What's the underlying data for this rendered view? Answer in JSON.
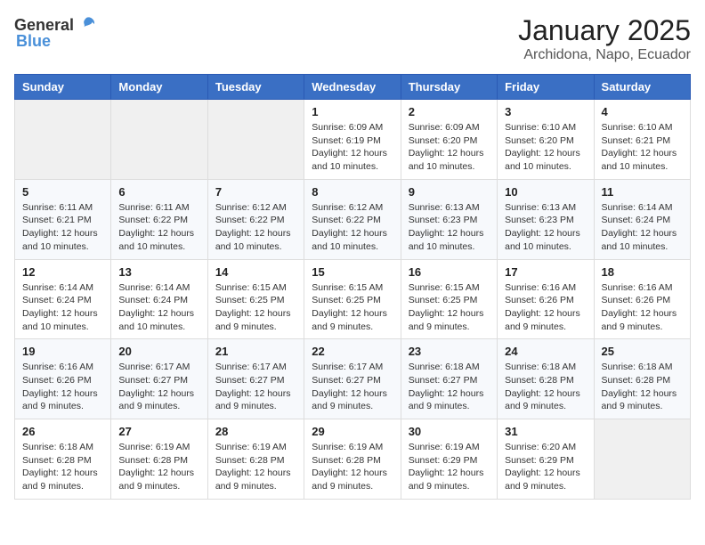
{
  "logo": {
    "text_general": "General",
    "text_blue": "Blue"
  },
  "title": "January 2025",
  "subtitle": "Archidona, Napo, Ecuador",
  "days_of_week": [
    "Sunday",
    "Monday",
    "Tuesday",
    "Wednesday",
    "Thursday",
    "Friday",
    "Saturday"
  ],
  "weeks": [
    [
      {
        "day": "",
        "info": ""
      },
      {
        "day": "",
        "info": ""
      },
      {
        "day": "",
        "info": ""
      },
      {
        "day": "1",
        "info": "Sunrise: 6:09 AM\nSunset: 6:19 PM\nDaylight: 12 hours and 10 minutes."
      },
      {
        "day": "2",
        "info": "Sunrise: 6:09 AM\nSunset: 6:20 PM\nDaylight: 12 hours and 10 minutes."
      },
      {
        "day": "3",
        "info": "Sunrise: 6:10 AM\nSunset: 6:20 PM\nDaylight: 12 hours and 10 minutes."
      },
      {
        "day": "4",
        "info": "Sunrise: 6:10 AM\nSunset: 6:21 PM\nDaylight: 12 hours and 10 minutes."
      }
    ],
    [
      {
        "day": "5",
        "info": "Sunrise: 6:11 AM\nSunset: 6:21 PM\nDaylight: 12 hours and 10 minutes."
      },
      {
        "day": "6",
        "info": "Sunrise: 6:11 AM\nSunset: 6:22 PM\nDaylight: 12 hours and 10 minutes."
      },
      {
        "day": "7",
        "info": "Sunrise: 6:12 AM\nSunset: 6:22 PM\nDaylight: 12 hours and 10 minutes."
      },
      {
        "day": "8",
        "info": "Sunrise: 6:12 AM\nSunset: 6:22 PM\nDaylight: 12 hours and 10 minutes."
      },
      {
        "day": "9",
        "info": "Sunrise: 6:13 AM\nSunset: 6:23 PM\nDaylight: 12 hours and 10 minutes."
      },
      {
        "day": "10",
        "info": "Sunrise: 6:13 AM\nSunset: 6:23 PM\nDaylight: 12 hours and 10 minutes."
      },
      {
        "day": "11",
        "info": "Sunrise: 6:14 AM\nSunset: 6:24 PM\nDaylight: 12 hours and 10 minutes."
      }
    ],
    [
      {
        "day": "12",
        "info": "Sunrise: 6:14 AM\nSunset: 6:24 PM\nDaylight: 12 hours and 10 minutes."
      },
      {
        "day": "13",
        "info": "Sunrise: 6:14 AM\nSunset: 6:24 PM\nDaylight: 12 hours and 10 minutes."
      },
      {
        "day": "14",
        "info": "Sunrise: 6:15 AM\nSunset: 6:25 PM\nDaylight: 12 hours and 9 minutes."
      },
      {
        "day": "15",
        "info": "Sunrise: 6:15 AM\nSunset: 6:25 PM\nDaylight: 12 hours and 9 minutes."
      },
      {
        "day": "16",
        "info": "Sunrise: 6:15 AM\nSunset: 6:25 PM\nDaylight: 12 hours and 9 minutes."
      },
      {
        "day": "17",
        "info": "Sunrise: 6:16 AM\nSunset: 6:26 PM\nDaylight: 12 hours and 9 minutes."
      },
      {
        "day": "18",
        "info": "Sunrise: 6:16 AM\nSunset: 6:26 PM\nDaylight: 12 hours and 9 minutes."
      }
    ],
    [
      {
        "day": "19",
        "info": "Sunrise: 6:16 AM\nSunset: 6:26 PM\nDaylight: 12 hours and 9 minutes."
      },
      {
        "day": "20",
        "info": "Sunrise: 6:17 AM\nSunset: 6:27 PM\nDaylight: 12 hours and 9 minutes."
      },
      {
        "day": "21",
        "info": "Sunrise: 6:17 AM\nSunset: 6:27 PM\nDaylight: 12 hours and 9 minutes."
      },
      {
        "day": "22",
        "info": "Sunrise: 6:17 AM\nSunset: 6:27 PM\nDaylight: 12 hours and 9 minutes."
      },
      {
        "day": "23",
        "info": "Sunrise: 6:18 AM\nSunset: 6:27 PM\nDaylight: 12 hours and 9 minutes."
      },
      {
        "day": "24",
        "info": "Sunrise: 6:18 AM\nSunset: 6:28 PM\nDaylight: 12 hours and 9 minutes."
      },
      {
        "day": "25",
        "info": "Sunrise: 6:18 AM\nSunset: 6:28 PM\nDaylight: 12 hours and 9 minutes."
      }
    ],
    [
      {
        "day": "26",
        "info": "Sunrise: 6:18 AM\nSunset: 6:28 PM\nDaylight: 12 hours and 9 minutes."
      },
      {
        "day": "27",
        "info": "Sunrise: 6:19 AM\nSunset: 6:28 PM\nDaylight: 12 hours and 9 minutes."
      },
      {
        "day": "28",
        "info": "Sunrise: 6:19 AM\nSunset: 6:28 PM\nDaylight: 12 hours and 9 minutes."
      },
      {
        "day": "29",
        "info": "Sunrise: 6:19 AM\nSunset: 6:28 PM\nDaylight: 12 hours and 9 minutes."
      },
      {
        "day": "30",
        "info": "Sunrise: 6:19 AM\nSunset: 6:29 PM\nDaylight: 12 hours and 9 minutes."
      },
      {
        "day": "31",
        "info": "Sunrise: 6:20 AM\nSunset: 6:29 PM\nDaylight: 12 hours and 9 minutes."
      },
      {
        "day": "",
        "info": ""
      }
    ]
  ]
}
